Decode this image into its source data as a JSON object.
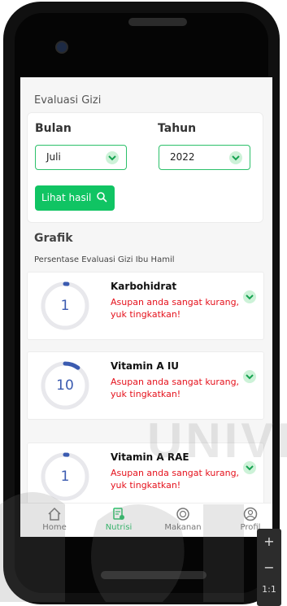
{
  "screen": {
    "title": "Evaluasi Gizi",
    "filter": {
      "month_label": "Bulan",
      "month_value": "Juli",
      "year_label": "Tahun",
      "year_value": "2022",
      "button_label": "Lihat hasil"
    },
    "section": {
      "title": "Grafik",
      "subtitle": "Persentase Evaluasi Gizi Ibu Hamil"
    },
    "nutrients": [
      {
        "name": "Karbohidrat",
        "value": "1",
        "status": "Asupan anda sangat kurang, yuk tingkatkan!",
        "percent": 1
      },
      {
        "name": "Vitamin A IU",
        "value": "10",
        "status": "Asupan anda sangat kurang, yuk tingkatkan!",
        "percent": 10
      },
      {
        "name": "Vitamin A RAE",
        "value": "1",
        "status": "Asupan anda sangat kurang, yuk tingkatkan!",
        "percent": 1
      }
    ],
    "nav": [
      {
        "label": "Home",
        "icon": "home-icon"
      },
      {
        "label": "Nutrisi",
        "icon": "nutrition-icon"
      },
      {
        "label": "Makanan",
        "icon": "food-icon"
      },
      {
        "label": "Profil",
        "icon": "profile-icon"
      }
    ]
  },
  "overlay": {
    "watermark_text": "UNIVER",
    "zoom_in": "+",
    "zoom_out": "−",
    "zoom_reset": "1:1"
  },
  "colors": {
    "accent": "#10c463",
    "warning": "#e5121d",
    "gauge": "#3b5bb0"
  }
}
